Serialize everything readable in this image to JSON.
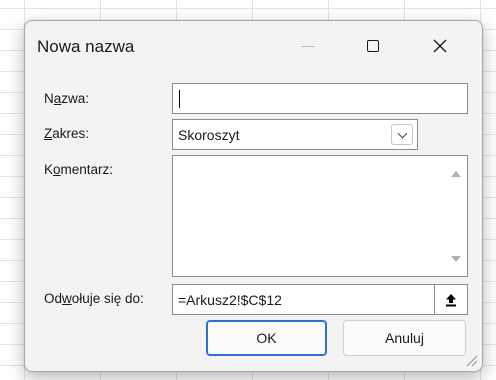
{
  "dialog": {
    "title": "Nowa nazwa",
    "buttons": {
      "ok": "OK",
      "cancel": "Anuluj"
    }
  },
  "fields": {
    "name": {
      "label_pre": "N",
      "label_u": "a",
      "label_post": "zwa:",
      "value": ""
    },
    "scope": {
      "label_pre": "",
      "label_u": "Z",
      "label_post": "akres:",
      "value": "Skoroszyt"
    },
    "comment": {
      "label_pre": "K",
      "label_u": "o",
      "label_post": "mentarz:",
      "value": ""
    },
    "refers_to": {
      "label_pre": "Od",
      "label_u": "w",
      "label_post": "ołuje się do:",
      "value": "=Arkusz2!$C$12"
    }
  },
  "icons": {
    "minimize": "minimize-icon",
    "maximize": "maximize-icon",
    "close": "close-icon",
    "dropdown": "chevron-down-icon",
    "collapse": "collapse-dialog-icon"
  }
}
